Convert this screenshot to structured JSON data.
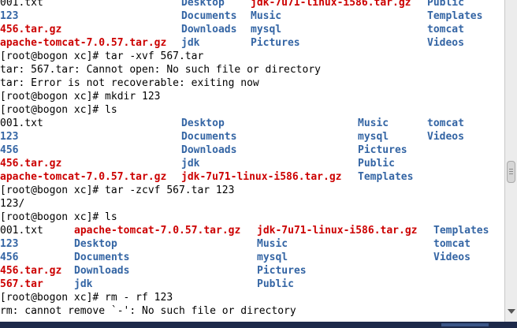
{
  "terminal": {
    "lines": [
      [
        {
          "t": "001.txt",
          "k": "plain",
          "col": 0
        },
        {
          "t": "Desktop",
          "k": "dir",
          "col": 230
        },
        {
          "t": "jdk-7u71-linux-i586.tar.gz",
          "k": "arc",
          "col": 318
        },
        {
          "t": "Public",
          "k": "dir",
          "col": 542
        }
      ],
      [
        {
          "t": "123",
          "k": "dir",
          "col": 0
        },
        {
          "t": "Documents",
          "k": "dir",
          "col": 230
        },
        {
          "t": "Music",
          "k": "dir",
          "col": 318
        },
        {
          "t": "Templates",
          "k": "dir",
          "col": 542
        }
      ],
      [
        {
          "t": "456.tar.gz",
          "k": "arc",
          "col": 0
        },
        {
          "t": "Downloads",
          "k": "dir",
          "col": 230
        },
        {
          "t": "mysql",
          "k": "dir",
          "col": 318
        },
        {
          "t": "tomcat",
          "k": "dir",
          "col": 542
        }
      ],
      [
        {
          "t": "apache-tomcat-7.0.57.tar.gz",
          "k": "arc",
          "col": 0
        },
        {
          "t": "jdk",
          "k": "dir",
          "col": 230
        },
        {
          "t": "Pictures",
          "k": "dir",
          "col": 318
        },
        {
          "t": "Videos",
          "k": "dir",
          "col": 542
        }
      ],
      [
        {
          "t": "[root@bogon xc]# tar -xvf 567.tar",
          "k": "plain",
          "col": 0
        }
      ],
      [
        {
          "t": "tar: 567.tar: Cannot open: No such file or directory",
          "k": "plain",
          "col": 0
        }
      ],
      [
        {
          "t": "tar: Error is not recoverable: exiting now",
          "k": "plain",
          "col": 0
        }
      ],
      [
        {
          "t": "[root@bogon xc]# mkdir 123",
          "k": "plain",
          "col": 0
        }
      ],
      [
        {
          "t": "[root@bogon xc]# ls",
          "k": "plain",
          "col": 0
        }
      ],
      [
        {
          "t": "001.txt",
          "k": "plain",
          "col": 0
        },
        {
          "t": "Desktop",
          "k": "dir",
          "col": 230
        },
        {
          "t": "Music",
          "k": "dir",
          "col": 454
        },
        {
          "t": "tomcat",
          "k": "dir",
          "col": 542
        }
      ],
      [
        {
          "t": "123",
          "k": "dir",
          "col": 0
        },
        {
          "t": "Documents",
          "k": "dir",
          "col": 230
        },
        {
          "t": "mysql",
          "k": "dir",
          "col": 454
        },
        {
          "t": "Videos",
          "k": "dir",
          "col": 542
        }
      ],
      [
        {
          "t": "456",
          "k": "dir",
          "col": 0
        },
        {
          "t": "Downloads",
          "k": "dir",
          "col": 230
        },
        {
          "t": "Pictures",
          "k": "dir",
          "col": 454
        }
      ],
      [
        {
          "t": "456.tar.gz",
          "k": "arc",
          "col": 0
        },
        {
          "t": "jdk",
          "k": "dir",
          "col": 230
        },
        {
          "t": "Public",
          "k": "dir",
          "col": 454
        }
      ],
      [
        {
          "t": "apache-tomcat-7.0.57.tar.gz",
          "k": "arc",
          "col": 0
        },
        {
          "t": "jdk-7u71-linux-i586.tar.gz",
          "k": "arc",
          "col": 230
        },
        {
          "t": "Templates",
          "k": "dir",
          "col": 454
        }
      ],
      [
        {
          "t": "[root@bogon xc]# tar -zcvf 567.tar 123",
          "k": "plain",
          "col": 0
        }
      ],
      [
        {
          "t": "123/",
          "k": "plain",
          "col": 0
        }
      ],
      [
        {
          "t": "[root@bogon xc]# ls",
          "k": "plain",
          "col": 0
        }
      ],
      [
        {
          "t": "001.txt",
          "k": "plain",
          "col": 0
        },
        {
          "t": "apache-tomcat-7.0.57.tar.gz",
          "k": "arc",
          "col": 94
        },
        {
          "t": "jdk-7u71-linux-i586.tar.gz",
          "k": "arc",
          "col": 326
        },
        {
          "t": "Templates",
          "k": "dir",
          "col": 550
        }
      ],
      [
        {
          "t": "123",
          "k": "dir",
          "col": 0
        },
        {
          "t": "Desktop",
          "k": "dir",
          "col": 94
        },
        {
          "t": "Music",
          "k": "dir",
          "col": 326
        },
        {
          "t": "tomcat",
          "k": "dir",
          "col": 550
        }
      ],
      [
        {
          "t": "456",
          "k": "dir",
          "col": 0
        },
        {
          "t": "Documents",
          "k": "dir",
          "col": 94
        },
        {
          "t": "mysql",
          "k": "dir",
          "col": 326
        },
        {
          "t": "Videos",
          "k": "dir",
          "col": 550
        }
      ],
      [
        {
          "t": "456.tar.gz",
          "k": "arc",
          "col": 0
        },
        {
          "t": "Downloads",
          "k": "dir",
          "col": 94
        },
        {
          "t": "Pictures",
          "k": "dir",
          "col": 326
        }
      ],
      [
        {
          "t": "567.tar",
          "k": "arc",
          "col": 0
        },
        {
          "t": "jdk",
          "k": "dir",
          "col": 94
        },
        {
          "t": "Public",
          "k": "dir",
          "col": 326
        }
      ],
      [
        {
          "t": "[root@bogon xc]# rm - rf 123",
          "k": "plain",
          "col": 0
        }
      ],
      [
        {
          "t": "rm: cannot remove `-': No such file or directory",
          "k": "plain",
          "col": 0
        }
      ]
    ]
  },
  "colors": {
    "background": "#ffffff",
    "text": "#000000",
    "directory": "#3465a4",
    "archive": "#cc0000"
  }
}
